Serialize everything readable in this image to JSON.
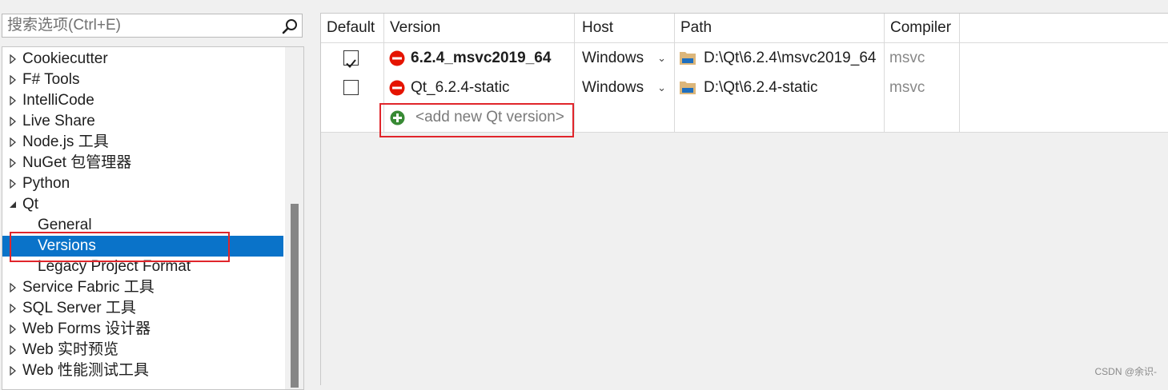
{
  "search": {
    "placeholder": "搜索选项(Ctrl+E)",
    "icon": "search-icon"
  },
  "tree": {
    "items": [
      {
        "label": "Cookiecutter",
        "expanded": false
      },
      {
        "label": "F# Tools",
        "expanded": false
      },
      {
        "label": "IntelliCode",
        "expanded": false
      },
      {
        "label": "Live Share",
        "expanded": false
      },
      {
        "label": "Node.js 工具",
        "expanded": false
      },
      {
        "label": "NuGet 包管理器",
        "expanded": false
      },
      {
        "label": "Python",
        "expanded": false
      },
      {
        "label": "Qt",
        "expanded": true
      },
      {
        "label": "General",
        "child": true
      },
      {
        "label": "Versions",
        "child": true,
        "selected": true
      },
      {
        "label": "Legacy Project Format",
        "child": true
      },
      {
        "label": "Service Fabric 工具",
        "expanded": false
      },
      {
        "label": "SQL Server 工具",
        "expanded": false
      },
      {
        "label": "Web Forms 设计器",
        "expanded": false
      },
      {
        "label": "Web 实时预览",
        "expanded": false
      },
      {
        "label": "Web 性能测试工具",
        "expanded": false
      }
    ]
  },
  "grid": {
    "headers": {
      "default": "Default",
      "version": "Version",
      "host": "Host",
      "path": "Path",
      "compiler": "Compiler"
    },
    "rows": [
      {
        "default": true,
        "version": "6.2.4_msvc2019_64",
        "is_default": true,
        "host": "Windows",
        "path": "D:\\Qt\\6.2.4\\msvc2019_64",
        "compiler": "msvc"
      },
      {
        "default": false,
        "version": "Qt_6.2.4-static",
        "is_default": false,
        "host": "Windows",
        "path": "D:\\Qt\\6.2.4-static",
        "compiler": "msvc"
      }
    ],
    "add_label": "<add new Qt version>"
  },
  "watermark": "CSDN @余识-",
  "colors": {
    "selection": "#0a73c9",
    "highlight_box": "#e0252b",
    "remove_icon": "#e51400",
    "add_icon": "#388a34",
    "folder_icon": "#dcb67a"
  }
}
